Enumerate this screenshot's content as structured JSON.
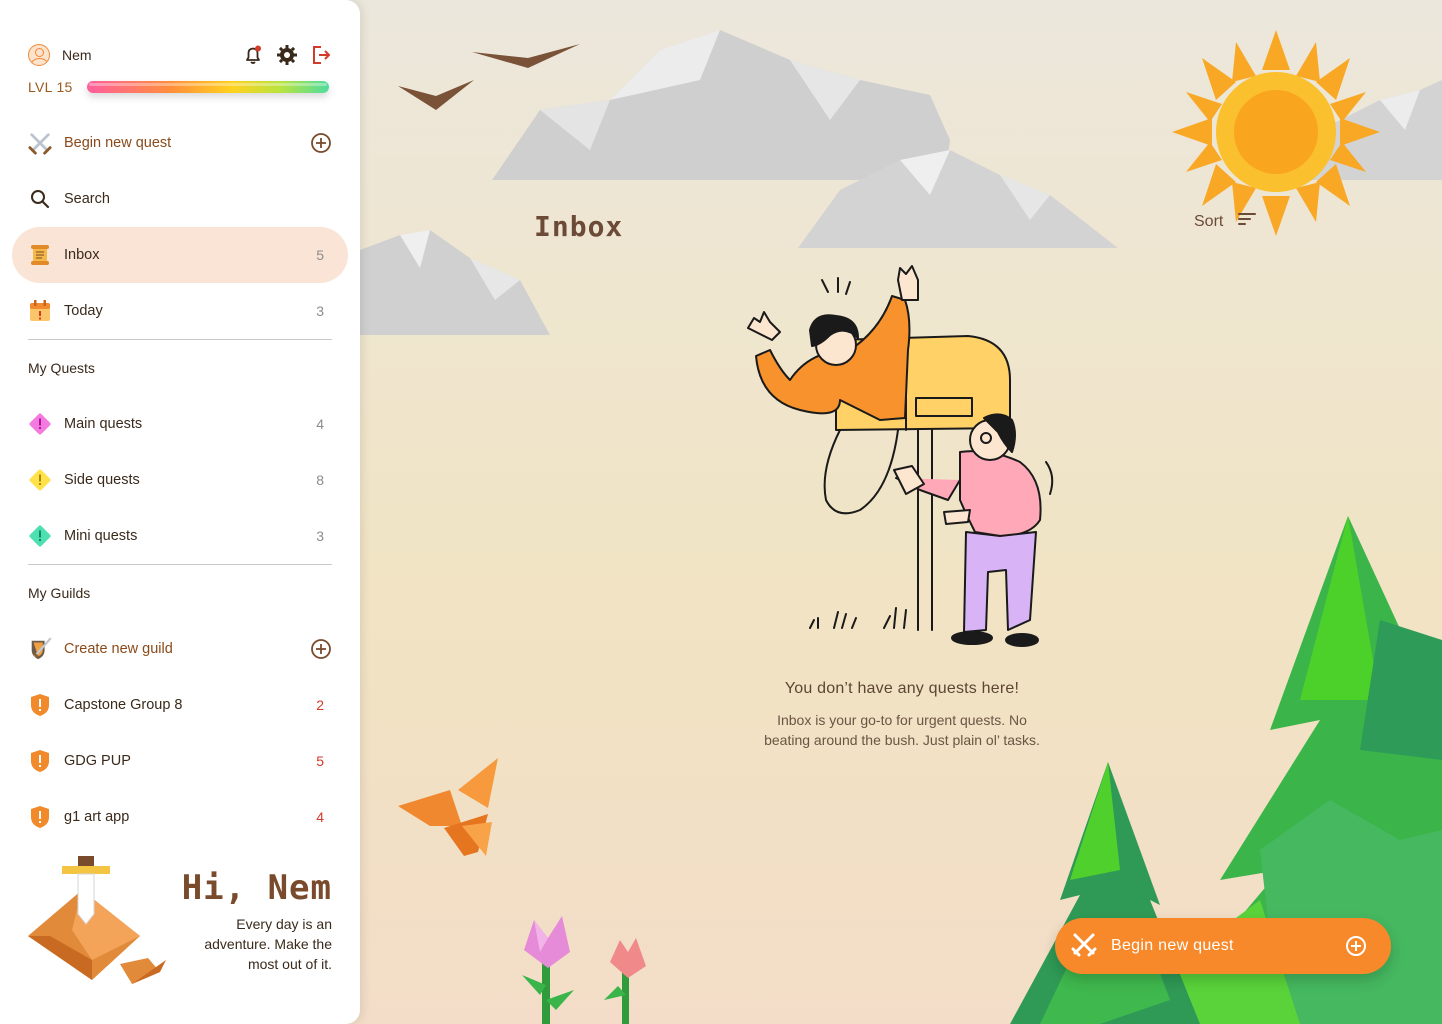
{
  "user": {
    "name": "Nem",
    "level_label": "LVL 15",
    "xp_progress": 1.0
  },
  "icons": {
    "bell": "notification-bell-icon",
    "gear": "settings-gear-icon",
    "logout": "logout-icon"
  },
  "nav": {
    "begin_quest": {
      "label": "Begin new quest"
    },
    "search": {
      "label": "Search"
    },
    "inbox": {
      "label": "Inbox",
      "count": "5"
    },
    "today": {
      "label": "Today",
      "count": "3"
    }
  },
  "my_quests": {
    "title": "My Quests",
    "items": [
      {
        "label": "Main quests",
        "count": "4",
        "color": "#f57ae0"
      },
      {
        "label": "Side quests",
        "count": "8",
        "color": "#ffe14a"
      },
      {
        "label": "Mini quests",
        "count": "3",
        "color": "#4ee0b0"
      }
    ]
  },
  "my_guilds": {
    "title": "My Guilds",
    "create_label": "Create new guild",
    "items": [
      {
        "label": "Capstone Group 8",
        "count": "2"
      },
      {
        "label": "GDG PUP",
        "count": "5"
      },
      {
        "label": "g1 art app",
        "count": "4"
      }
    ]
  },
  "greeting": {
    "title": "Hi, Nem",
    "subtitle": "Every day is an adventure. Make the most out of it."
  },
  "content": {
    "title": "Inbox",
    "sort_label": "Sort",
    "empty_title": "You don’t have any quests here!",
    "empty_subtitle": "Inbox is your go-to for urgent quests. No beating around the bush. Just plain ol’ tasks."
  },
  "fab": {
    "label": "Begin new quest"
  },
  "colors": {
    "accent": "#f7892a",
    "active_nav": "#f9e4d5",
    "brown_text": "#8a4a1a",
    "guild_shield": "#f08a2a",
    "count_red": "#d43a2a"
  }
}
